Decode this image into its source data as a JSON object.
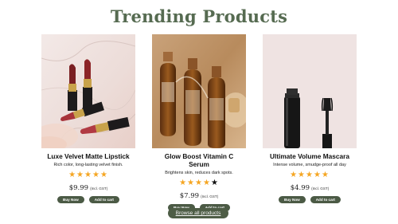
{
  "section_title": "Trending Products",
  "products": [
    {
      "name": "Luxe Velvet Matte Lipstick",
      "description": "Rich color, long-lasting velvet finish.",
      "rating": 5,
      "price": "$9.99",
      "price_note": "(Incl. GST)",
      "buy_label": "Buy Now",
      "cart_label": "Add to cart"
    },
    {
      "name": "Glow Boost Vitamin C Serum",
      "description": "Brightens skin, reduces dark spots.",
      "rating": 4,
      "price": "$7.99",
      "price_note": "(Incl. GST)",
      "buy_label": "Buy Now",
      "cart_label": "Add to cart"
    },
    {
      "name": "Ultimate Volume Mascara",
      "description": "Intense volume, smudge-proof all day",
      "rating": 5,
      "price": "$4.99",
      "price_note": "(Incl. GST)",
      "buy_label": "Buy Now",
      "cart_label": "Add to cart"
    }
  ],
  "browse_all_label": "Browse all products",
  "colors": {
    "title": "#566b51",
    "button": "#4b5a45",
    "star": "#f5a623"
  }
}
